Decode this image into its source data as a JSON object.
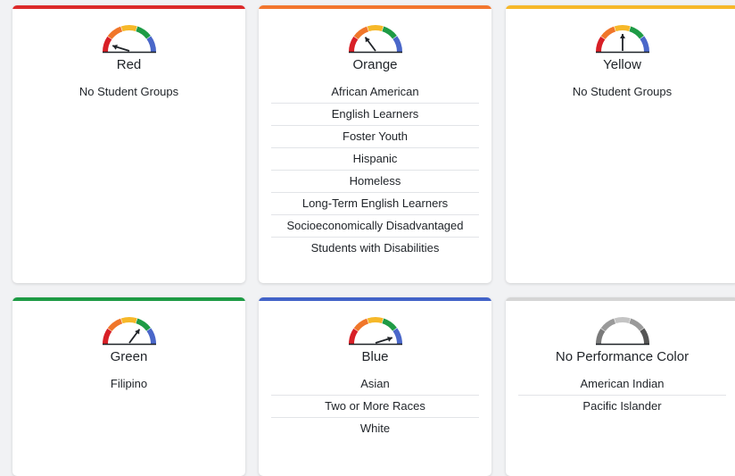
{
  "cards": [
    {
      "title": "Red",
      "bar_color": "#dc2a2a",
      "needle": "red",
      "groups": [
        "No Student Groups"
      ],
      "gray": false
    },
    {
      "title": "Orange",
      "bar_color": "#f2762e",
      "needle": "orange",
      "groups": [
        "African American",
        "English Learners",
        "Foster Youth",
        "Hispanic",
        "Homeless",
        "Long-Term English Learners",
        "Socioeconomically Disadvantaged",
        "Students with Disabilities"
      ],
      "gray": false
    },
    {
      "title": "Yellow",
      "bar_color": "#f6b829",
      "needle": "yellow",
      "groups": [
        "No Student Groups"
      ],
      "gray": false
    },
    {
      "title": "Green",
      "bar_color": "#1e9b45",
      "needle": "green",
      "groups": [
        "Filipino"
      ],
      "gray": false
    },
    {
      "title": "Blue",
      "bar_color": "#4263c8",
      "needle": "blue",
      "groups": [
        "Asian",
        "Two or More Races",
        "White"
      ],
      "gray": false
    },
    {
      "title": "No Performance Color",
      "bar_color": "#d5d5d5",
      "needle": "none",
      "groups": [
        "American Indian",
        "Pacific Islander"
      ],
      "gray": true
    }
  ],
  "colors": {
    "red": "#d81f26",
    "orange": "#f0762a",
    "yellow": "#f6b829",
    "green": "#1e9b45",
    "blue": "#4a67c9"
  }
}
